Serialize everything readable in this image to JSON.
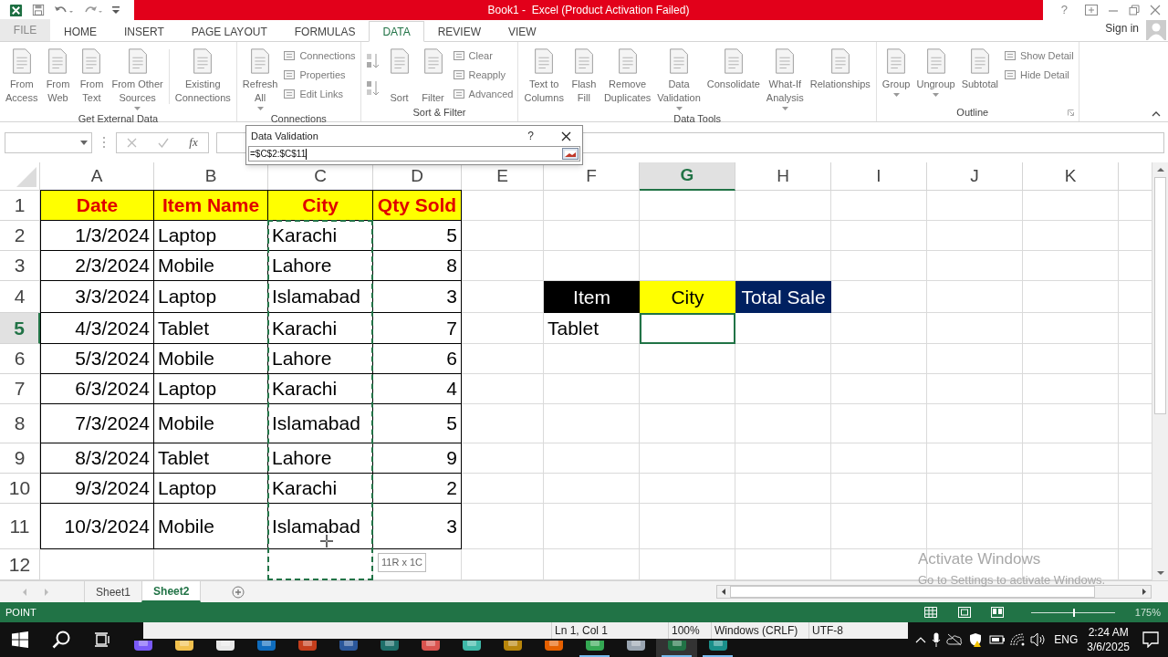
{
  "title_bar": {
    "title": "Book1 -  Excel (Product Activation Failed)",
    "help": "?"
  },
  "ribbon_tabs": [
    {
      "label": "FILE",
      "kind": "file",
      "selected": false
    },
    {
      "label": "HOME",
      "kind": "tab",
      "selected": false
    },
    {
      "label": "INSERT",
      "kind": "tab",
      "selected": false
    },
    {
      "label": "PAGE LAYOUT",
      "kind": "tab",
      "selected": false
    },
    {
      "label": "FORMULAS",
      "kind": "tab",
      "selected": false
    },
    {
      "label": "DATA",
      "kind": "tab",
      "selected": true
    },
    {
      "label": "REVIEW",
      "kind": "tab",
      "selected": false
    },
    {
      "label": "VIEW",
      "kind": "tab",
      "selected": false
    }
  ],
  "account": {
    "label": "Sign in"
  },
  "ribbon_groups": [
    {
      "label": "Get External Data",
      "launcher": false,
      "buttons": [
        {
          "kind": "large",
          "label": "From\nAccess",
          "dropdown": false
        },
        {
          "kind": "large",
          "label": "From\nWeb",
          "dropdown": false
        },
        {
          "kind": "large",
          "label": "From\nText",
          "dropdown": false
        },
        {
          "kind": "large",
          "label": "From Other\nSources",
          "dropdown": true
        },
        {
          "kind": "separator"
        },
        {
          "kind": "large",
          "label": "Existing\nConnections",
          "dropdown": false
        }
      ]
    },
    {
      "label": "Connections",
      "launcher": false,
      "buttons": [
        {
          "kind": "large",
          "label": "Refresh\nAll",
          "dropdown": true
        },
        {
          "kind": "stack",
          "items": [
            "Connections",
            "Properties",
            "Edit Links"
          ]
        }
      ]
    },
    {
      "label": "Sort & Filter",
      "launcher": false,
      "buttons": [
        {
          "kind": "sort_pair"
        },
        {
          "kind": "large",
          "label": "\nSort",
          "dropdown": false
        },
        {
          "kind": "large",
          "label": "\nFilter",
          "dropdown": false
        },
        {
          "kind": "stack",
          "items": [
            "Clear",
            "Reapply",
            "Advanced"
          ]
        }
      ]
    },
    {
      "label": "Data Tools",
      "launcher": false,
      "buttons": [
        {
          "kind": "large",
          "label": "Text to\nColumns",
          "dropdown": false
        },
        {
          "kind": "large",
          "label": "Flash\nFill",
          "dropdown": false
        },
        {
          "kind": "large",
          "label": "Remove\nDuplicates",
          "dropdown": false
        },
        {
          "kind": "large",
          "label": "Data\nValidation",
          "dropdown": true
        },
        {
          "kind": "large",
          "label": "Consolidate",
          "dropdown": false
        },
        {
          "kind": "large",
          "label": "What-If\nAnalysis",
          "dropdown": true
        },
        {
          "kind": "large",
          "label": "Relationships",
          "dropdown": false
        }
      ]
    },
    {
      "label": "Outline",
      "launcher": true,
      "buttons": [
        {
          "kind": "large",
          "label": "Group",
          "dropdown": true
        },
        {
          "kind": "large",
          "label": "Ungroup",
          "dropdown": true
        },
        {
          "kind": "large",
          "label": "Subtotal",
          "dropdown": false
        },
        {
          "kind": "stack",
          "items": [
            "Show Detail",
            "Hide Detail"
          ]
        }
      ]
    }
  ],
  "formula_bar": {
    "function_label": "fx"
  },
  "dialog": {
    "title": "Data Validation",
    "help": "?",
    "value": "=$C$2:$C$11"
  },
  "sheet": {
    "columns": [
      {
        "letter": "A",
        "selected": false
      },
      {
        "letter": "B",
        "selected": false
      },
      {
        "letter": "C",
        "selected": false
      },
      {
        "letter": "D",
        "selected": false
      },
      {
        "letter": "E",
        "selected": false
      },
      {
        "letter": "F",
        "selected": false
      },
      {
        "letter": "G",
        "selected": true
      },
      {
        "letter": "H",
        "selected": false
      },
      {
        "letter": "I",
        "selected": false
      },
      {
        "letter": "J",
        "selected": false
      },
      {
        "letter": "K",
        "selected": false
      }
    ],
    "rows": [
      {
        "number": "1",
        "selected": false
      },
      {
        "number": "2",
        "selected": false
      },
      {
        "number": "3",
        "selected": false
      },
      {
        "number": "4",
        "selected": false
      },
      {
        "number": "5",
        "selected": true
      },
      {
        "number": "6",
        "selected": false
      },
      {
        "number": "7",
        "selected": false
      },
      {
        "number": "8",
        "selected": false
      },
      {
        "number": "9",
        "selected": false
      },
      {
        "number": "10",
        "selected": false
      },
      {
        "number": "11",
        "selected": false
      },
      {
        "number": "12",
        "selected": false
      }
    ],
    "selection_tooltip": "11R x 1C"
  },
  "data_table": {
    "columns": [
      {
        "header": "Date",
        "kind": "number",
        "copied": false
      },
      {
        "header": "Item Name",
        "kind": "text",
        "copied": false
      },
      {
        "header": "City",
        "kind": "text",
        "copied": true
      },
      {
        "header": "Qty Sold",
        "kind": "number",
        "copied": false
      }
    ],
    "rows": [
      [
        "1/3/2024",
        "Laptop",
        "Karachi",
        "5"
      ],
      [
        "2/3/2024",
        "Mobile",
        "Lahore",
        "8"
      ],
      [
        "3/3/2024",
        "Laptop",
        "Islamabad",
        "3"
      ],
      [
        "4/3/2024",
        "Tablet",
        "Karachi",
        "7"
      ],
      [
        "5/3/2024",
        "Mobile",
        "Lahore",
        "6"
      ],
      [
        "6/3/2024",
        "Laptop",
        "Karachi",
        "4"
      ],
      [
        "7/3/2024",
        "Mobile",
        "Islamabad",
        "5"
      ],
      [
        "8/3/2024",
        "Tablet",
        "Lahore",
        "9"
      ],
      [
        "9/3/2024",
        "Laptop",
        "Karachi",
        "2"
      ],
      [
        "10/3/2024",
        "Mobile",
        "Islamabad",
        "3"
      ]
    ]
  },
  "summary_table": {
    "headers": [
      {
        "text": "Item",
        "kind": "dark"
      },
      {
        "text": "City",
        "kind": "yellow"
      },
      {
        "text": "Total Sale",
        "kind": "navy"
      }
    ],
    "cells": [
      {
        "text": "Tablet",
        "selected": false
      },
      {
        "selected": true
      }
    ]
  },
  "sheet_tabs": [
    {
      "label": "Sheet1",
      "selected": false
    },
    {
      "label": "Sheet2",
      "selected": true
    }
  ],
  "status_bar": {
    "mode": "POINT",
    "zoom": "175%",
    "zoom_slider": {
      "level": 0.5
    }
  },
  "activation_notice": {
    "title": "Activate Windows",
    "subtitle": "Go to Settings to activate Windows."
  },
  "notepad_status": [
    "Ln 1, Col 1",
    "100%",
    "Windows (CRLF)",
    "UTF-8"
  ],
  "taskbar": {
    "apps": [
      {
        "color": "#7a5af8",
        "running": false,
        "active": false
      },
      {
        "color": "#f2c14e",
        "running": false,
        "active": false
      },
      {
        "color": "#e8e8e8",
        "running": false,
        "active": false
      },
      {
        "color": "#0f6cbd",
        "running": false,
        "active": false
      },
      {
        "color": "#c43e1c",
        "running": false,
        "active": false
      },
      {
        "color": "#2b579a",
        "running": false,
        "active": false
      },
      {
        "color": "#1e6f6a",
        "running": false,
        "active": false
      },
      {
        "color": "#d9534f",
        "running": false,
        "active": false
      },
      {
        "color": "#3fb8a8",
        "running": false,
        "active": false
      },
      {
        "color": "#b8860b",
        "running": false,
        "active": false
      },
      {
        "color": "#e66000",
        "running": false,
        "active": false
      },
      {
        "color": "#34a853",
        "running": true,
        "active": false
      },
      {
        "color": "#9aa5b1",
        "running": false,
        "active": false
      },
      {
        "color": "#217346",
        "running": true,
        "active": true
      },
      {
        "color": "#1a8f8a",
        "running": true,
        "active": false
      }
    ],
    "language": "ENG",
    "time": "2:24 AM",
    "date": "3/6/2025"
  }
}
